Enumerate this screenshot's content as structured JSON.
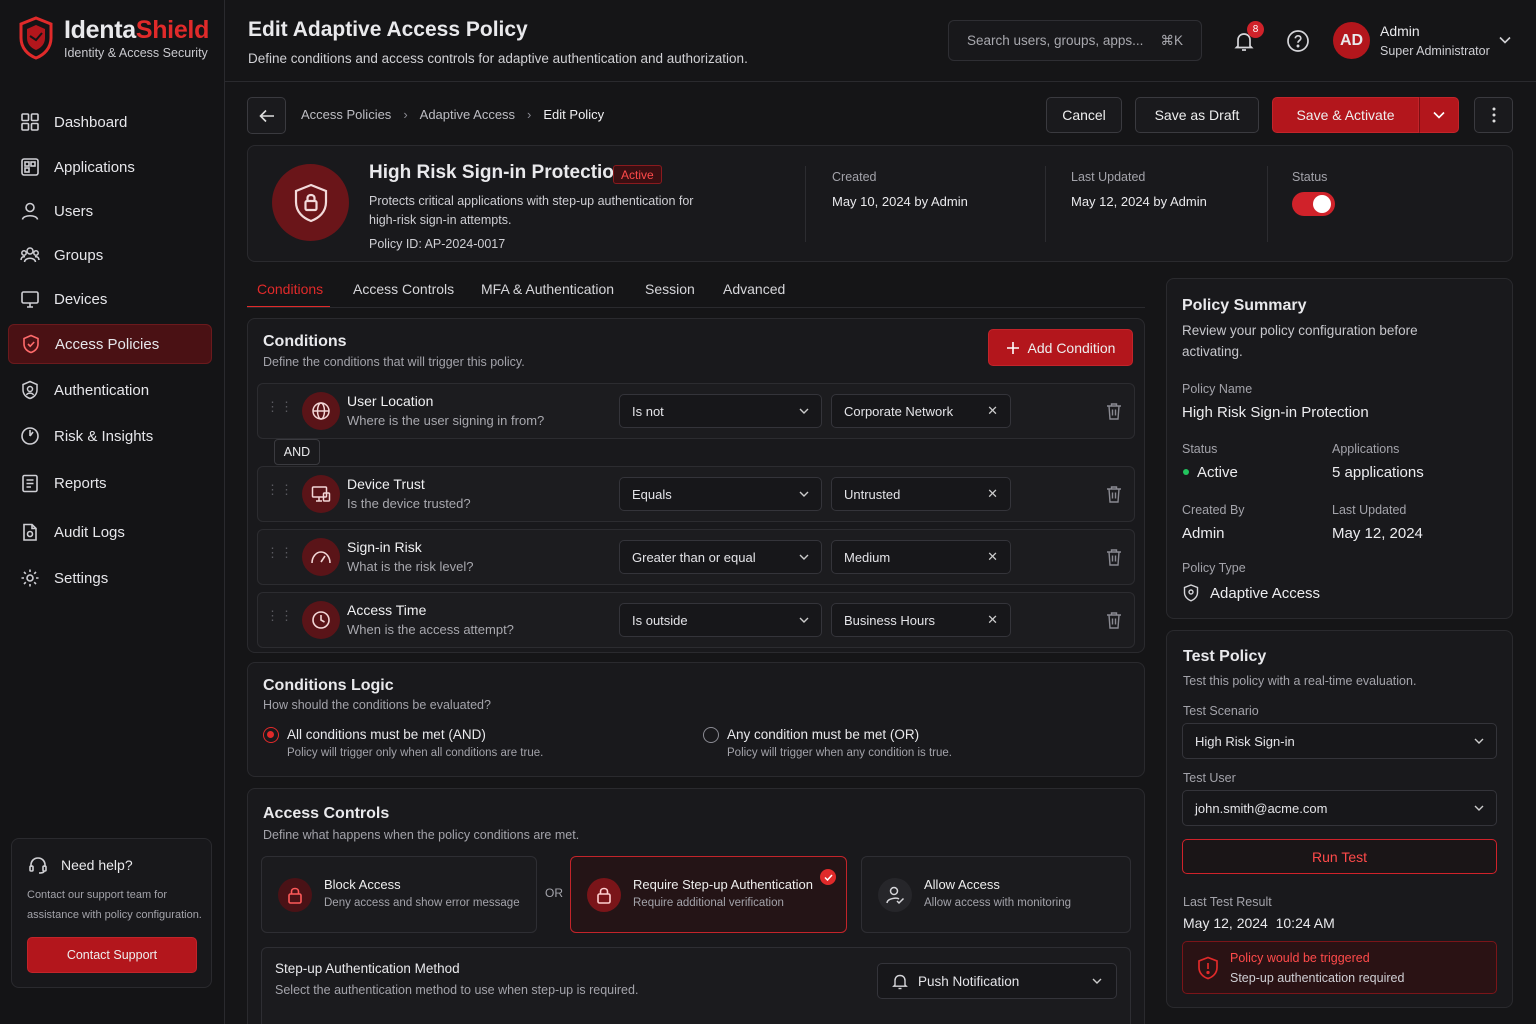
{
  "brand": {
    "name_a": "Identa",
    "name_b": "Shield",
    "tagline": "Identity & Access Security"
  },
  "sidebar": {
    "items": [
      {
        "label": "Dashboard",
        "icon": "dashboard-icon"
      },
      {
        "label": "Applications",
        "icon": "applications-icon"
      },
      {
        "label": "Users",
        "icon": "user-icon"
      },
      {
        "label": "Groups",
        "icon": "groups-icon"
      },
      {
        "label": "Devices",
        "icon": "monitor-icon"
      },
      {
        "label": "Access Policies",
        "icon": "shield-icon",
        "active": true
      },
      {
        "label": "Authentication",
        "icon": "fingerprint-icon"
      },
      {
        "label": "Risk & Insights",
        "icon": "risk-icon"
      },
      {
        "label": "Reports",
        "icon": "reports-icon"
      },
      {
        "label": "Audit Logs",
        "icon": "audit-icon"
      },
      {
        "label": "Settings",
        "icon": "gear-icon"
      }
    ],
    "help": {
      "title": "Need help?",
      "text_1": "Contact our support team for",
      "text_2": "assistance with policy configuration.",
      "button": "Contact Support"
    }
  },
  "header": {
    "title": "Edit Adaptive Access Policy",
    "subtitle": "Define conditions and access controls for adaptive authentication and authorization.",
    "search_placeholder": "Search users, groups, apps...",
    "search_shortcut": "⌘K",
    "notifications": "8",
    "user_initials": "AD",
    "user_name": "Admin",
    "user_role": "Super Administrator"
  },
  "breadcrumb": {
    "items": [
      "Access Policies",
      "Adaptive Access",
      "Edit Policy"
    ]
  },
  "actions": {
    "cancel": "Cancel",
    "draft": "Save as Draft",
    "activate": "Save & Activate"
  },
  "policy": {
    "name": "High Risk Sign-in Protection",
    "badge": "Active",
    "desc_1": "Protects critical applications with step-up authentication for",
    "desc_2": "high-risk sign-in attempts.",
    "id_label": "Policy ID:",
    "id": "AP-2024-0017",
    "created_label": "Created",
    "created": "May 10, 2024 by Admin",
    "updated_label": "Last Updated",
    "updated": "May 12, 2024 by Admin",
    "status_label": "Status",
    "status_on": true
  },
  "tabs": [
    "Conditions",
    "Access Controls",
    "MFA & Authentication",
    "Session",
    "Advanced"
  ],
  "conditions": {
    "title": "Conditions",
    "subtitle": "Define the conditions that will trigger this policy.",
    "add": "Add Condition",
    "join": "AND",
    "rows": [
      {
        "title": "User Location",
        "sub": "Where is the user signing in from?",
        "op": "Is not",
        "value": "Corporate Network",
        "icon": "globe-icon"
      },
      {
        "title": "Device Trust",
        "sub": "Is the device trusted?",
        "op": "Equals",
        "value": "Untrusted",
        "icon": "device-icon"
      },
      {
        "title": "Sign-in Risk",
        "sub": "What is the risk level?",
        "op": "Greater than or equal",
        "value": "Medium",
        "icon": "gauge-icon"
      },
      {
        "title": "Access Time",
        "sub": "When is the access attempt?",
        "op": "Is outside",
        "value": "Business Hours",
        "icon": "clock-icon"
      }
    ]
  },
  "logic": {
    "title": "Conditions Logic",
    "subtitle": "How should the conditions be evaluated?",
    "opt1": "All conditions must be met (AND)",
    "opt1_sub": "Policy will trigger only when all conditions are true.",
    "opt2": "Any condition must be met (OR)",
    "opt2_sub": "Policy will trigger when any condition is true."
  },
  "access": {
    "title": "Access Controls",
    "subtitle": "Define what happens when the policy conditions are met.",
    "or": "OR",
    "block": {
      "title": "Block Access",
      "sub": "Deny access and show error message"
    },
    "stepup": {
      "title": "Require Step-up Authentication",
      "sub": "Require additional verification"
    },
    "allow": {
      "title": "Allow Access",
      "sub": "Allow access with monitoring"
    },
    "method_title": "Step-up Authentication Method",
    "method_sub": "Select the authentication method to use when step-up is required.",
    "method": "Push Notification"
  },
  "summary": {
    "title": "Policy Summary",
    "sub_1": "Review your policy configuration before",
    "sub_2": "activating.",
    "name_label": "Policy Name",
    "name": "High Risk Sign-in Protection",
    "status_label": "Status",
    "status": "Active",
    "apps_label": "Applications",
    "apps": "5 applications",
    "by_label": "Created By",
    "by": "Admin",
    "upd_label": "Last Updated",
    "upd": "May 12, 2024",
    "type_label": "Policy Type",
    "type": "Adaptive Access"
  },
  "test": {
    "title": "Test Policy",
    "subtitle": "Test this policy with a real-time evaluation.",
    "scenario_label": "Test Scenario",
    "scenario": "High Risk Sign-in",
    "user_label": "Test User",
    "user": "john.smith@acme.com",
    "run": "Run Test",
    "last_label": "Last Test Result",
    "last": "May 12, 2024  10:24 AM",
    "result_title": "Policy would be triggered",
    "result_sub": "Step-up authentication required"
  },
  "colors": {
    "accent": "#b3161c",
    "accent_bright": "#e02a2a",
    "bg": "#151517",
    "panel": "#19191c",
    "success": "#22c55e"
  }
}
